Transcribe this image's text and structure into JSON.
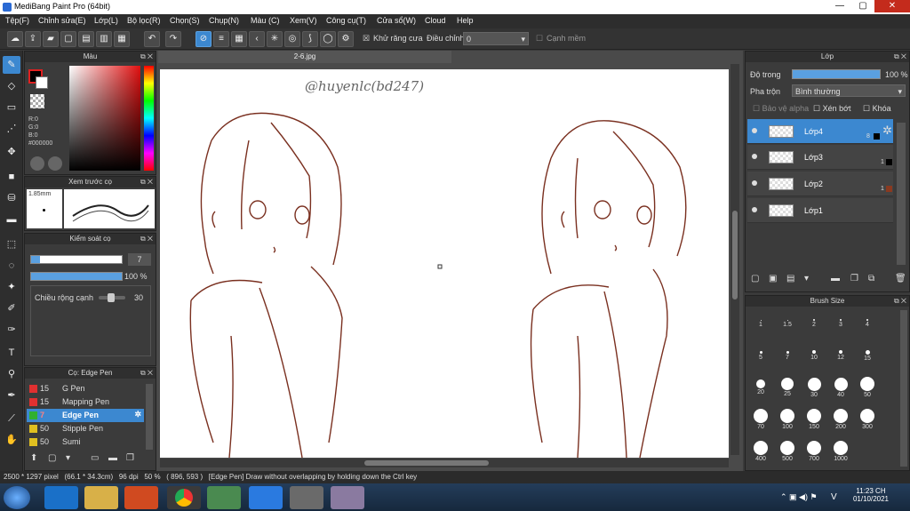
{
  "window": {
    "title": "MediBang Paint Pro (64bit)",
    "min": "—",
    "max": "▢",
    "close": "✕"
  },
  "menu": [
    "Tệp(F)",
    "Chỉnh sửa(E)",
    "Lớp(L)",
    "Bộ lọc(R)",
    "Chọn(S)",
    "Chụp(N)",
    "Màu (C)",
    "Xem(V)",
    "Công cụ(T)",
    "Cửa sổ(W)",
    "Cloud",
    "Help"
  ],
  "toolbar": {
    "antialias_label": "Khử răng cưa",
    "correction_label": "Điều chỉnh",
    "correction_value": "0",
    "snap_label": "Cạnh mềm"
  },
  "color_panel": {
    "title": "Màu",
    "r": "R:0",
    "g": "G:0",
    "b": "B:0",
    "hex": "#000000"
  },
  "preview_panel": {
    "title": "Xem trước cọ",
    "size": "1.85mm"
  },
  "brush_control": {
    "title": "Kiểm soát cọ",
    "size_value": "7",
    "opacity_value": "100 %",
    "edge_label": "Chiều rộng cạnh",
    "edge_value": "30"
  },
  "brush_list": {
    "title": "Cọ: Edge Pen",
    "items": [
      {
        "size": "15",
        "name": "G Pen",
        "color": "#e03030"
      },
      {
        "size": "15",
        "name": "Mapping Pen",
        "color": "#e03030"
      },
      {
        "size": "7",
        "name": "Edge Pen",
        "color": "#30b030"
      },
      {
        "size": "50",
        "name": "Stipple Pen",
        "color": "#e0c020"
      },
      {
        "size": "50",
        "name": "Sumi",
        "color": "#e0c020"
      }
    ]
  },
  "document": {
    "tab": "2-6.jpg",
    "watermark": "@huyenlc(bd247)"
  },
  "layer_panel": {
    "title": "Lớp",
    "opacity_label": "Độ trong",
    "opacity_value": "100 %",
    "blend_label": "Pha trộn",
    "blend_value": "Bình thường",
    "protect_alpha": "Bảo vệ alpha",
    "clipping": "Xén bớt",
    "lock": "Khóa",
    "layers": [
      {
        "name": "Lớp4",
        "count": "8"
      },
      {
        "name": "Lớp3",
        "count": "1"
      },
      {
        "name": "Lớp2",
        "count": "1"
      },
      {
        "name": "Lớp1",
        "count": ""
      }
    ]
  },
  "brush_size_panel": {
    "title": "Brush Size",
    "sizes": [
      "1",
      "1.5",
      "2",
      "3",
      "4",
      "5",
      "7",
      "10",
      "12",
      "15",
      "20",
      "25",
      "30",
      "40",
      "50",
      "70",
      "100",
      "150",
      "200",
      "300",
      "400",
      "500",
      "700",
      "1000"
    ]
  },
  "status": "2500 * 1297 pixel   (66.1 * 34.3cm)   96 dpi   50 %   ( 896, 593 )   [Edge Pen] Draw without overlapping by holding down the Ctrl key",
  "taskbar": {
    "time": "11:23 CH",
    "date": "01/10/2021",
    "lang": "V"
  }
}
